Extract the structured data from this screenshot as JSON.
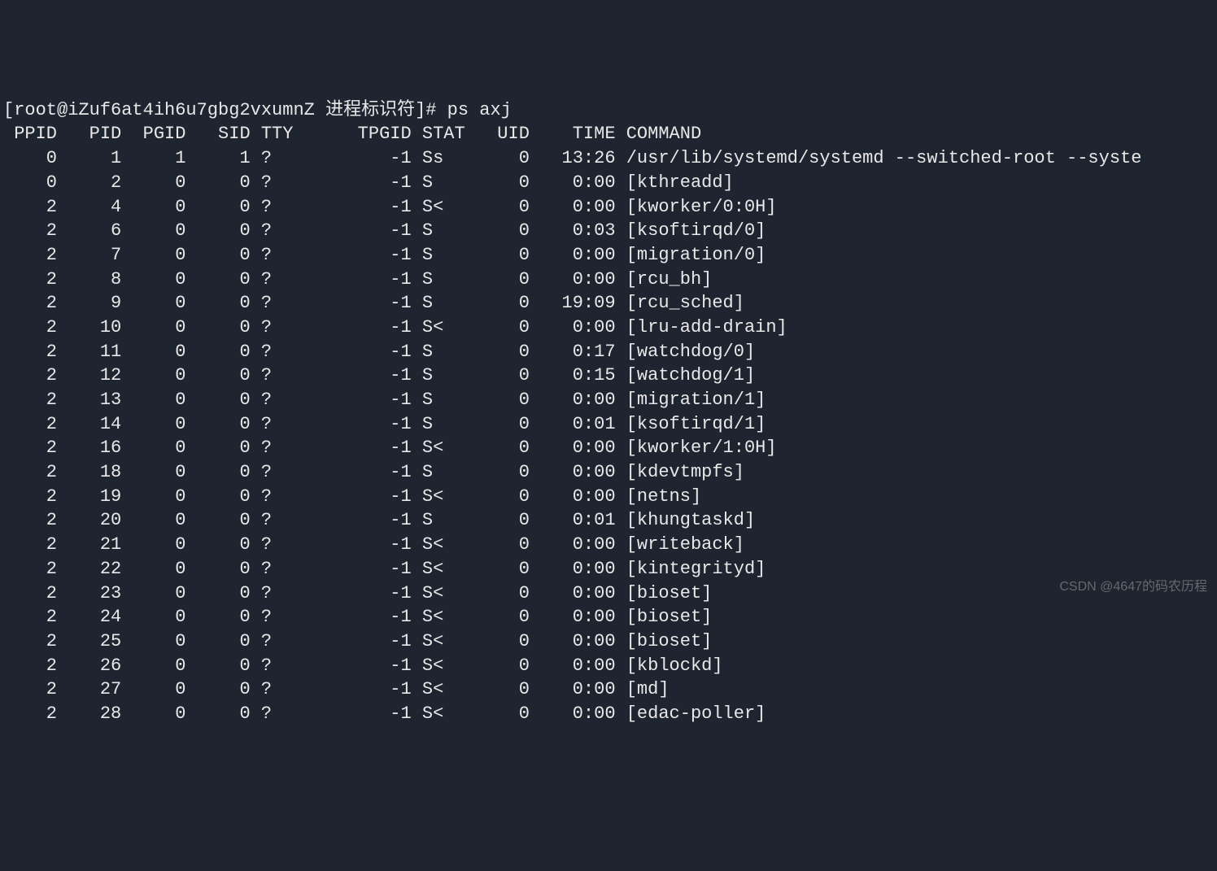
{
  "prompt": "[root@iZuf6at4ih6u7gbg2vxumnZ 进程标识符]# ps axj",
  "headers": [
    "PPID",
    "PID",
    "PGID",
    "SID",
    "TTY",
    "TPGID",
    "STAT",
    "UID",
    "TIME",
    "COMMAND"
  ],
  "rows": [
    {
      "ppid": "0",
      "pid": "1",
      "pgid": "1",
      "sid": "1",
      "tty": "?",
      "tpgid": "-1",
      "stat": "Ss",
      "uid": "0",
      "time": "13:26",
      "command": "/usr/lib/systemd/systemd --switched-root --syste"
    },
    {
      "ppid": "0",
      "pid": "2",
      "pgid": "0",
      "sid": "0",
      "tty": "?",
      "tpgid": "-1",
      "stat": "S",
      "uid": "0",
      "time": "0:00",
      "command": "[kthreadd]"
    },
    {
      "ppid": "2",
      "pid": "4",
      "pgid": "0",
      "sid": "0",
      "tty": "?",
      "tpgid": "-1",
      "stat": "S<",
      "uid": "0",
      "time": "0:00",
      "command": "[kworker/0:0H]"
    },
    {
      "ppid": "2",
      "pid": "6",
      "pgid": "0",
      "sid": "0",
      "tty": "?",
      "tpgid": "-1",
      "stat": "S",
      "uid": "0",
      "time": "0:03",
      "command": "[ksoftirqd/0]"
    },
    {
      "ppid": "2",
      "pid": "7",
      "pgid": "0",
      "sid": "0",
      "tty": "?",
      "tpgid": "-1",
      "stat": "S",
      "uid": "0",
      "time": "0:00",
      "command": "[migration/0]"
    },
    {
      "ppid": "2",
      "pid": "8",
      "pgid": "0",
      "sid": "0",
      "tty": "?",
      "tpgid": "-1",
      "stat": "S",
      "uid": "0",
      "time": "0:00",
      "command": "[rcu_bh]"
    },
    {
      "ppid": "2",
      "pid": "9",
      "pgid": "0",
      "sid": "0",
      "tty": "?",
      "tpgid": "-1",
      "stat": "S",
      "uid": "0",
      "time": "19:09",
      "command": "[rcu_sched]"
    },
    {
      "ppid": "2",
      "pid": "10",
      "pgid": "0",
      "sid": "0",
      "tty": "?",
      "tpgid": "-1",
      "stat": "S<",
      "uid": "0",
      "time": "0:00",
      "command": "[lru-add-drain]"
    },
    {
      "ppid": "2",
      "pid": "11",
      "pgid": "0",
      "sid": "0",
      "tty": "?",
      "tpgid": "-1",
      "stat": "S",
      "uid": "0",
      "time": "0:17",
      "command": "[watchdog/0]"
    },
    {
      "ppid": "2",
      "pid": "12",
      "pgid": "0",
      "sid": "0",
      "tty": "?",
      "tpgid": "-1",
      "stat": "S",
      "uid": "0",
      "time": "0:15",
      "command": "[watchdog/1]"
    },
    {
      "ppid": "2",
      "pid": "13",
      "pgid": "0",
      "sid": "0",
      "tty": "?",
      "tpgid": "-1",
      "stat": "S",
      "uid": "0",
      "time": "0:00",
      "command": "[migration/1]"
    },
    {
      "ppid": "2",
      "pid": "14",
      "pgid": "0",
      "sid": "0",
      "tty": "?",
      "tpgid": "-1",
      "stat": "S",
      "uid": "0",
      "time": "0:01",
      "command": "[ksoftirqd/1]"
    },
    {
      "ppid": "2",
      "pid": "16",
      "pgid": "0",
      "sid": "0",
      "tty": "?",
      "tpgid": "-1",
      "stat": "S<",
      "uid": "0",
      "time": "0:00",
      "command": "[kworker/1:0H]"
    },
    {
      "ppid": "2",
      "pid": "18",
      "pgid": "0",
      "sid": "0",
      "tty": "?",
      "tpgid": "-1",
      "stat": "S",
      "uid": "0",
      "time": "0:00",
      "command": "[kdevtmpfs]"
    },
    {
      "ppid": "2",
      "pid": "19",
      "pgid": "0",
      "sid": "0",
      "tty": "?",
      "tpgid": "-1",
      "stat": "S<",
      "uid": "0",
      "time": "0:00",
      "command": "[netns]"
    },
    {
      "ppid": "2",
      "pid": "20",
      "pgid": "0",
      "sid": "0",
      "tty": "?",
      "tpgid": "-1",
      "stat": "S",
      "uid": "0",
      "time": "0:01",
      "command": "[khungtaskd]"
    },
    {
      "ppid": "2",
      "pid": "21",
      "pgid": "0",
      "sid": "0",
      "tty": "?",
      "tpgid": "-1",
      "stat": "S<",
      "uid": "0",
      "time": "0:00",
      "command": "[writeback]"
    },
    {
      "ppid": "2",
      "pid": "22",
      "pgid": "0",
      "sid": "0",
      "tty": "?",
      "tpgid": "-1",
      "stat": "S<",
      "uid": "0",
      "time": "0:00",
      "command": "[kintegrityd]"
    },
    {
      "ppid": "2",
      "pid": "23",
      "pgid": "0",
      "sid": "0",
      "tty": "?",
      "tpgid": "-1",
      "stat": "S<",
      "uid": "0",
      "time": "0:00",
      "command": "[bioset]"
    },
    {
      "ppid": "2",
      "pid": "24",
      "pgid": "0",
      "sid": "0",
      "tty": "?",
      "tpgid": "-1",
      "stat": "S<",
      "uid": "0",
      "time": "0:00",
      "command": "[bioset]"
    },
    {
      "ppid": "2",
      "pid": "25",
      "pgid": "0",
      "sid": "0",
      "tty": "?",
      "tpgid": "-1",
      "stat": "S<",
      "uid": "0",
      "time": "0:00",
      "command": "[bioset]"
    },
    {
      "ppid": "2",
      "pid": "26",
      "pgid": "0",
      "sid": "0",
      "tty": "?",
      "tpgid": "-1",
      "stat": "S<",
      "uid": "0",
      "time": "0:00",
      "command": "[kblockd]"
    },
    {
      "ppid": "2",
      "pid": "27",
      "pgid": "0",
      "sid": "0",
      "tty": "?",
      "tpgid": "-1",
      "stat": "S<",
      "uid": "0",
      "time": "0:00",
      "command": "[md]"
    },
    {
      "ppid": "2",
      "pid": "28",
      "pgid": "0",
      "sid": "0",
      "tty": "?",
      "tpgid": "-1",
      "stat": "S<",
      "uid": "0",
      "time": "0:00",
      "command": "[edac-poller]"
    }
  ],
  "watermark": "CSDN @4647的码农历程"
}
